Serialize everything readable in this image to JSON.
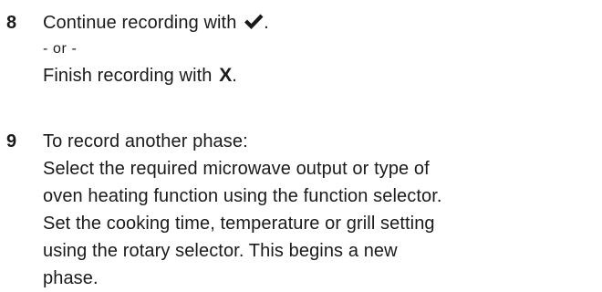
{
  "steps": [
    {
      "number": "8",
      "continue_text": "Continue recording with",
      "continue_end": ".",
      "or_text": "- or -",
      "finish_text": "Finish recording  with",
      "finish_symbol": "X",
      "finish_end": ".",
      "icons": [
        "check-icon",
        "x-icon"
      ]
    },
    {
      "number": "9",
      "lines": [
        "To record another phase:",
        "Select the required microwave output or type of",
        "oven heating  function using the function selector.",
        "Set the cooking time, temperature or grill  setting",
        "using the rotary selector. This begins a new",
        "phase."
      ]
    }
  ]
}
